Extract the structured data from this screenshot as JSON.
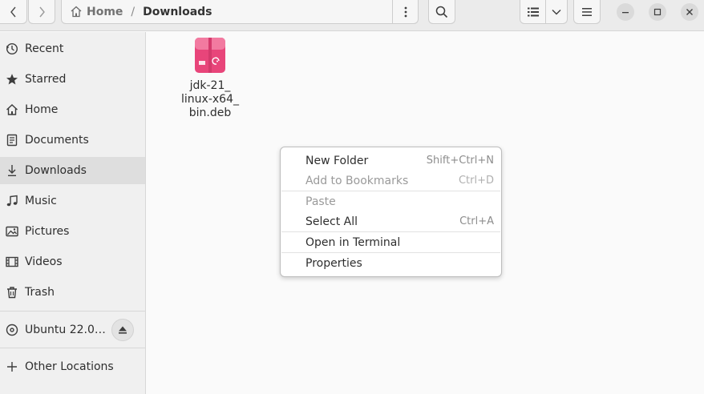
{
  "header": {
    "path_home": "Home",
    "path_separator": "/",
    "path_current": "Downloads"
  },
  "sidebar": {
    "items": [
      {
        "label": "Recent",
        "icon": "clock-icon"
      },
      {
        "label": "Starred",
        "icon": "star-icon"
      },
      {
        "label": "Home",
        "icon": "home-icon"
      },
      {
        "label": "Documents",
        "icon": "document-icon"
      },
      {
        "label": "Downloads",
        "icon": "download-icon"
      },
      {
        "label": "Music",
        "icon": "music-icon"
      },
      {
        "label": "Pictures",
        "icon": "picture-icon"
      },
      {
        "label": "Videos",
        "icon": "video-icon"
      },
      {
        "label": "Trash",
        "icon": "trash-icon"
      }
    ],
    "devices": [
      {
        "label": "Ubuntu 22.0…",
        "icon": "disc-icon"
      }
    ],
    "other": {
      "label": "Other Locations",
      "icon": "plus-icon"
    }
  },
  "files": [
    {
      "name_lines": [
        "jdk-21_",
        "linux-x64_",
        "bin.deb"
      ],
      "icon": "deb-package-icon"
    }
  ],
  "context_menu": {
    "items": [
      {
        "label": "New Folder",
        "accel": "Shift+Ctrl+N",
        "enabled": true
      },
      {
        "label": "Add to Bookmarks",
        "accel": "Ctrl+D",
        "enabled": false
      },
      {
        "label": "Paste",
        "accel": "",
        "enabled": false
      },
      {
        "label": "Select All",
        "accel": "Ctrl+A",
        "enabled": true
      },
      {
        "label": "Open in Terminal",
        "accel": "",
        "enabled": true
      },
      {
        "label": "Properties",
        "accel": "",
        "enabled": true
      }
    ]
  },
  "colors": {
    "deb_icon": "#e8457a",
    "deb_icon_light": "#f27aa0"
  }
}
